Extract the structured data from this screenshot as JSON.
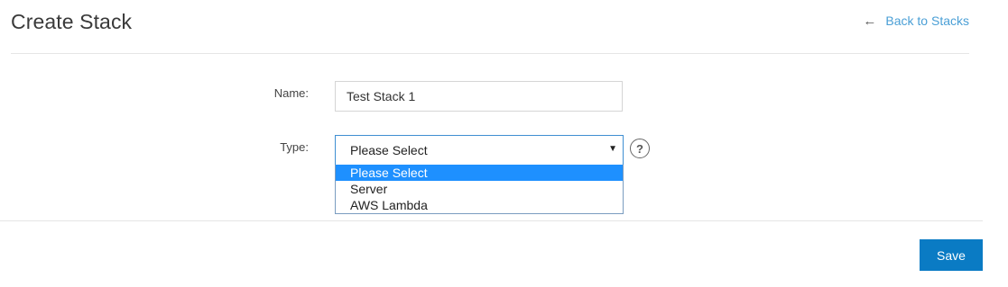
{
  "header": {
    "title": "Create Stack",
    "back_link": "Back to Stacks",
    "back_icon": "arrow-left-icon"
  },
  "form": {
    "name_label": "Name:",
    "name_value": "Test Stack 1",
    "type_label": "Type:",
    "type_selected": "Please Select",
    "type_options": [
      "Please Select",
      "Server",
      "AWS Lambda"
    ],
    "help_icon": "question-circle-icon",
    "help_glyph": "?"
  },
  "footer": {
    "save_label": "Save"
  },
  "colors": {
    "accent": "#0a7bc4",
    "link": "#4a9fd6",
    "option_highlight": "#1e90ff"
  }
}
